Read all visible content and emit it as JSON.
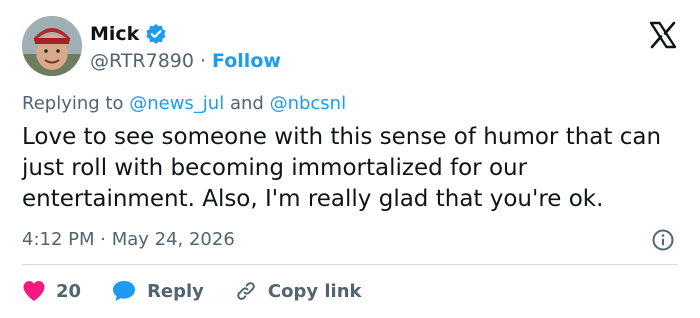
{
  "author": {
    "name": "Mick",
    "handle": "@RTR7890",
    "separator": "·",
    "follow_label": "Follow"
  },
  "replying": {
    "prefix": "Replying to",
    "mention1": "@news_jul",
    "and": "and",
    "mention2": "@nbcsnl"
  },
  "tweet": {
    "text": "Love to see someone with this sense of humor that can just roll with becoming immortalized for our entertainment.  Also, I'm really glad that you're ok.",
    "timestamp": "4:12 PM · May 24, 2026"
  },
  "actions": {
    "likes": "20",
    "reply_label": "Reply",
    "copy_label": "Copy link"
  },
  "colors": {
    "accent": "#1d9bf0",
    "like": "#f91880",
    "muted": "#536471"
  }
}
